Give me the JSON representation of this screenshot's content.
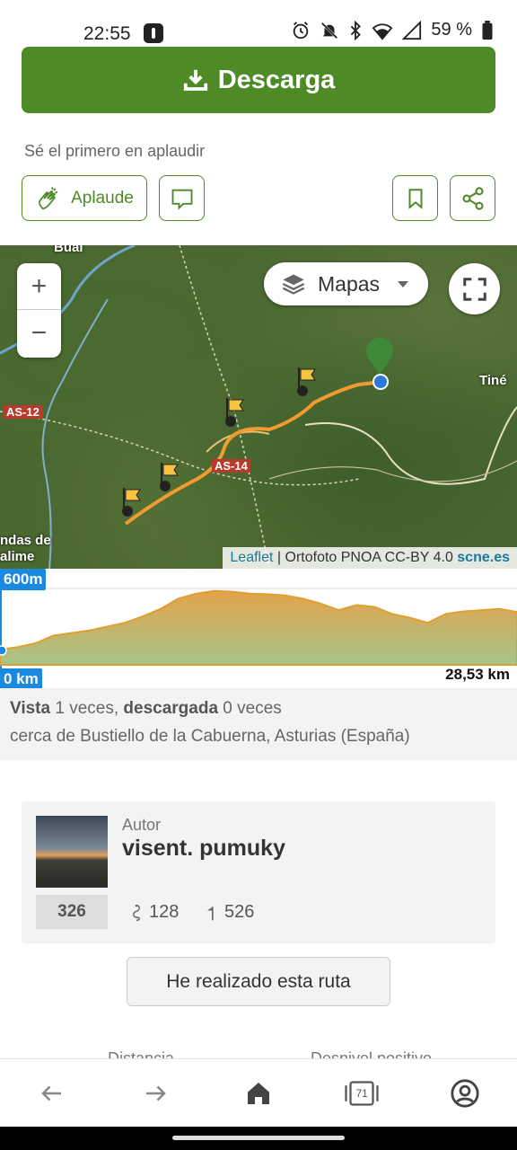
{
  "status_bar": {
    "time": "22:55",
    "battery": "59 %",
    "icons": [
      "alarm-icon",
      "mute-icon",
      "bluetooth-icon",
      "wifi-icon",
      "signal-icon",
      "battery-icon"
    ]
  },
  "download": {
    "label": "Descarga",
    "icon": "download-icon"
  },
  "applaud": {
    "prompt": "Sé el primero en aplaudir",
    "button_label": "Aplaude"
  },
  "map": {
    "layers_label": "Mapas",
    "attribution": {
      "leaflet": "Leaflet",
      "separator": " | Ortofoto PNOA CC-BY 4.0 ",
      "source": "scne.es"
    },
    "labels": {
      "town1": "Bual",
      "town2": "Tiné",
      "road1": "AS-12",
      "road2": "AS-14",
      "place1": "ndas de",
      "place2": "alime"
    },
    "zoom_in": "+",
    "zoom_out": "−"
  },
  "elevation": {
    "y_max_label": "600m",
    "x_min_label": "0 km",
    "x_max_label": "28,53 km",
    "profile_m": [
      120,
      140,
      170,
      230,
      250,
      270,
      300,
      330,
      380,
      440,
      520,
      560,
      580,
      575,
      560,
      555,
      545,
      520,
      480,
      430,
      470,
      455,
      400,
      370,
      330,
      400,
      420,
      430,
      440,
      415
    ]
  },
  "route_stats": {
    "views_label": "Vista",
    "views_text": " 1 veces, ",
    "downloads_label": "descargada",
    "downloads_text": " 0 veces",
    "location": "cerca de Bustiello de la Cabuerna, Asturias (España)"
  },
  "author": {
    "label": "Autor",
    "name": "visent. pumuky",
    "count": "326",
    "routes": "128",
    "followers": "526"
  },
  "done_button": "He realizado esta ruta",
  "cutoff_labels": {
    "distance": "Distancia",
    "elevation_gain": "Desnivel positivo"
  },
  "bottom_nav": {
    "tabs_count": "71"
  }
}
